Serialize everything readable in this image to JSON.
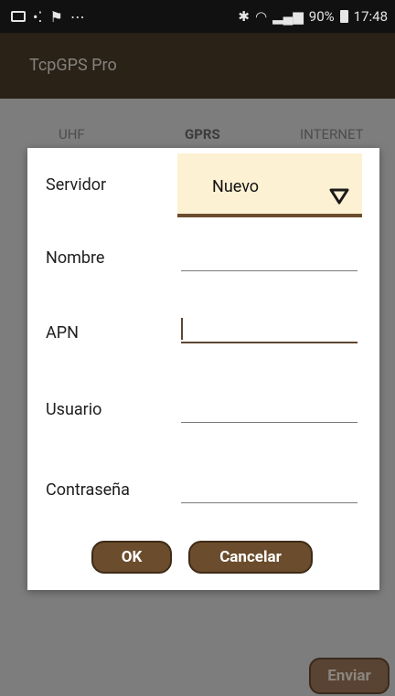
{
  "status_bar": {
    "battery": "90%",
    "time": "17:48"
  },
  "app": {
    "title": "TcpGPS Pro"
  },
  "tabs": [
    {
      "label": "UHF"
    },
    {
      "label": "GPRS"
    },
    {
      "label": "INTERNET"
    }
  ],
  "dialog": {
    "servidor_label": "Servidor",
    "servidor_value": "Nuevo",
    "nombre_label": "Nombre",
    "nombre_value": "",
    "apn_label": "APN",
    "apn_value": "",
    "usuario_label": "Usuario",
    "usuario_value": "",
    "contrasena_label": "Contraseña",
    "contrasena_value": "",
    "ok_label": "OK",
    "cancel_label": "Cancelar"
  },
  "footer": {
    "send_label": "Enviar"
  },
  "colors": {
    "brand_brown": "#6b4d2d",
    "selector_bg": "#fdf1d3",
    "appbar_dark": "#2a2117"
  }
}
